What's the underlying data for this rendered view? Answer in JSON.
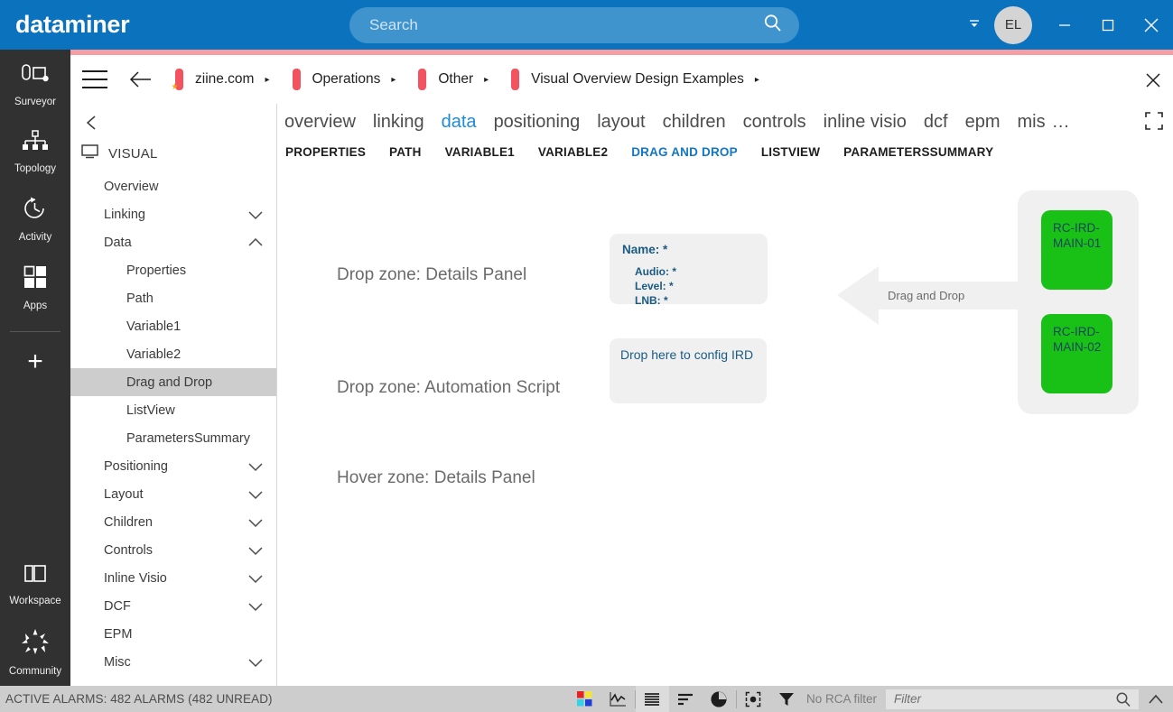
{
  "titlebar": {
    "brand": "dataminer",
    "search_placeholder": "Search",
    "search_value": "",
    "search_icon": "magnifier-icon",
    "caret_icon": "chevron-down-icon",
    "avatar_initials": "EL",
    "minimize_label": "—",
    "maximize_label": "□",
    "close_label": "✕",
    "accent_color": "#0b72bd"
  },
  "rail": {
    "items": [
      {
        "label": "Surveyor",
        "icon": "surveyor-icon"
      },
      {
        "label": "Topology",
        "icon": "topology-icon"
      },
      {
        "label": "Activity",
        "icon": "activity-clock-icon"
      },
      {
        "label": "Apps",
        "icon": "apps-grid-icon"
      }
    ],
    "add_label": "+",
    "bottom_items": [
      {
        "label": "Workspace",
        "icon": "workspace-icon"
      },
      {
        "label": "Community",
        "icon": "community-icon"
      }
    ]
  },
  "breadcrumb": {
    "menu_icon": "hamburger-icon",
    "back_icon": "arrow-left-icon",
    "close_icon": "close-icon",
    "items": [
      {
        "label": "ziine.com",
        "icon": "element-icon",
        "arrow": "▸"
      },
      {
        "label": "Operations",
        "icon": "element-icon",
        "arrow": "▸"
      },
      {
        "label": "Other",
        "icon": "element-icon",
        "arrow": "▸"
      },
      {
        "label": "Visual Overview Design Examples",
        "icon": "element-icon",
        "arrow": "▸"
      }
    ]
  },
  "tree": {
    "collapse_icon": "chevron-left-icon",
    "root_icon": "monitor-icon",
    "root_label": "VISUAL",
    "nodes": [
      {
        "label": "Overview",
        "level": 1,
        "chevron": "",
        "selected": false
      },
      {
        "label": "Linking",
        "level": 1,
        "chevron": "down",
        "selected": false
      },
      {
        "label": "Data",
        "level": 1,
        "chevron": "up",
        "selected": false
      },
      {
        "label": "Properties",
        "level": 2,
        "chevron": "",
        "selected": false
      },
      {
        "label": "Path",
        "level": 2,
        "chevron": "",
        "selected": false
      },
      {
        "label": "Variable1",
        "level": 2,
        "chevron": "",
        "selected": false
      },
      {
        "label": "Variable2",
        "level": 2,
        "chevron": "",
        "selected": false
      },
      {
        "label": "Drag and Drop",
        "level": 2,
        "chevron": "",
        "selected": true
      },
      {
        "label": "ListView",
        "level": 2,
        "chevron": "",
        "selected": false
      },
      {
        "label": "ParametersSummary",
        "level": 2,
        "chevron": "",
        "selected": false
      },
      {
        "label": "Positioning",
        "level": 1,
        "chevron": "down",
        "selected": false
      },
      {
        "label": "Layout",
        "level": 1,
        "chevron": "down",
        "selected": false
      },
      {
        "label": "Children",
        "level": 1,
        "chevron": "down",
        "selected": false
      },
      {
        "label": "Controls",
        "level": 1,
        "chevron": "down",
        "selected": false
      },
      {
        "label": "Inline Visio",
        "level": 1,
        "chevron": "down",
        "selected": false
      },
      {
        "label": "DCF",
        "level": 1,
        "chevron": "down",
        "selected": false
      },
      {
        "label": "EPM",
        "level": 1,
        "chevron": "",
        "selected": false
      },
      {
        "label": "Misc",
        "level": 1,
        "chevron": "down",
        "selected": false
      }
    ]
  },
  "tabs": {
    "items": [
      {
        "label": "overview",
        "active": false
      },
      {
        "label": "linking",
        "active": false
      },
      {
        "label": "data",
        "active": true
      },
      {
        "label": "positioning",
        "active": false
      },
      {
        "label": "layout",
        "active": false
      },
      {
        "label": "children",
        "active": false
      },
      {
        "label": "controls",
        "active": false
      },
      {
        "label": "inline visio",
        "active": false
      },
      {
        "label": "dcf",
        "active": false
      },
      {
        "label": "epm",
        "active": false
      },
      {
        "label": "mis",
        "active": false
      }
    ],
    "overflow_label": "…",
    "fullscreen_icon": "fullscreen-icon"
  },
  "subtabs": {
    "items": [
      {
        "label": "PROPERTIES",
        "active": false
      },
      {
        "label": "PATH",
        "active": false
      },
      {
        "label": "VARIABLE1",
        "active": false
      },
      {
        "label": "VARIABLE2",
        "active": false
      },
      {
        "label": "DRAG AND DROP",
        "active": true
      },
      {
        "label": "LISTVIEW",
        "active": false
      },
      {
        "label": "PARAMETERSSUMMARY",
        "active": false
      }
    ]
  },
  "stage": {
    "zone_details_label": "Drop zone: Details Panel",
    "zone_automation_label": "Drop zone: Automation Script",
    "zone_hover_label": "Hover zone: Details Panel",
    "details_panel": {
      "name_line": "Name: *",
      "rows": [
        "Audio: *",
        "Level: *",
        "LNB: *"
      ]
    },
    "automation_drop": {
      "text": "Drop here to config IRD"
    },
    "arrow_label": "Drag and Drop",
    "element_panel": {
      "boxes": [
        {
          "label": "RC-IRD-MAIN-01",
          "color": "#19c116"
        },
        {
          "label": "RC-IRD-MAIN-02",
          "color": "#19c116"
        }
      ]
    }
  },
  "statusbar": {
    "alarm_text": "ACTIVE ALARMS: 482 ALARMS (482 UNREAD)",
    "icons": [
      {
        "name": "alarm-tiles-icon",
        "active": false
      },
      {
        "name": "trend-chart-icon",
        "active": false
      },
      {
        "name": "list-view-icon",
        "active": true
      },
      {
        "name": "bar-chart-icon",
        "active": false
      },
      {
        "name": "pie-chart-icon",
        "active": false
      },
      {
        "name": "focus-target-icon",
        "active": false
      }
    ],
    "rca_filter_icon": "funnel-icon",
    "rca_filter_text": "No RCA filter",
    "filter_placeholder": "Filter",
    "filter_value": "",
    "filter_search_icon": "magnifier-icon",
    "expand_icon": "chevron-up-icon"
  }
}
